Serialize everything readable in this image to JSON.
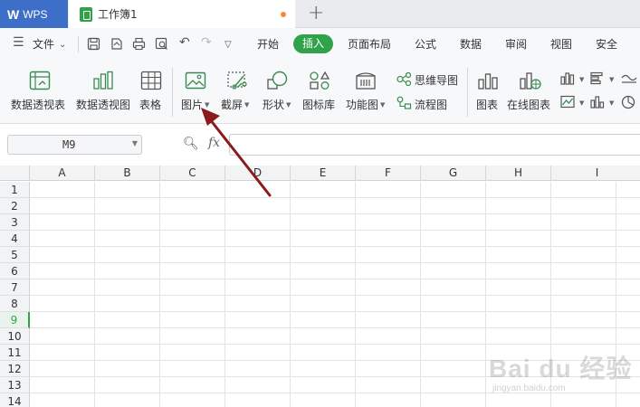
{
  "titlebar": {
    "app_logo": "W",
    "app_name": "WPS",
    "document_tab": "工作簿1",
    "new_tab": "+"
  },
  "menubar": {
    "file_menu": "文件",
    "tabs": [
      "开始",
      "插入",
      "页面布局",
      "公式",
      "数据",
      "审阅",
      "视图",
      "安全"
    ],
    "active_tab": "插入"
  },
  "ribbon": {
    "buttons": [
      "数据透视表",
      "数据透视图",
      "表格",
      "图片",
      "截屏",
      "形状",
      "图标库",
      "功能图",
      "图表",
      "在线图表"
    ],
    "small_buttons": [
      "思维导图",
      "流程图"
    ]
  },
  "formula_bar": {
    "name_box": "M9",
    "fx": "fx",
    "formula": ""
  },
  "grid": {
    "columns": [
      "A",
      "B",
      "C",
      "D",
      "E",
      "F",
      "G",
      "H",
      "I"
    ],
    "rows": [
      "1",
      "2",
      "3",
      "4",
      "5",
      "6",
      "7",
      "8",
      "9",
      "10",
      "11",
      "12",
      "13",
      "14"
    ],
    "active_row": "9"
  },
  "watermark": {
    "main": "Bai du 经验",
    "sub": "jingyan.baidu.com"
  },
  "colors": {
    "accent_green": "#2fa24a",
    "wps_blue": "#3d6fc8",
    "arrow_red": "#8b1a1a"
  }
}
